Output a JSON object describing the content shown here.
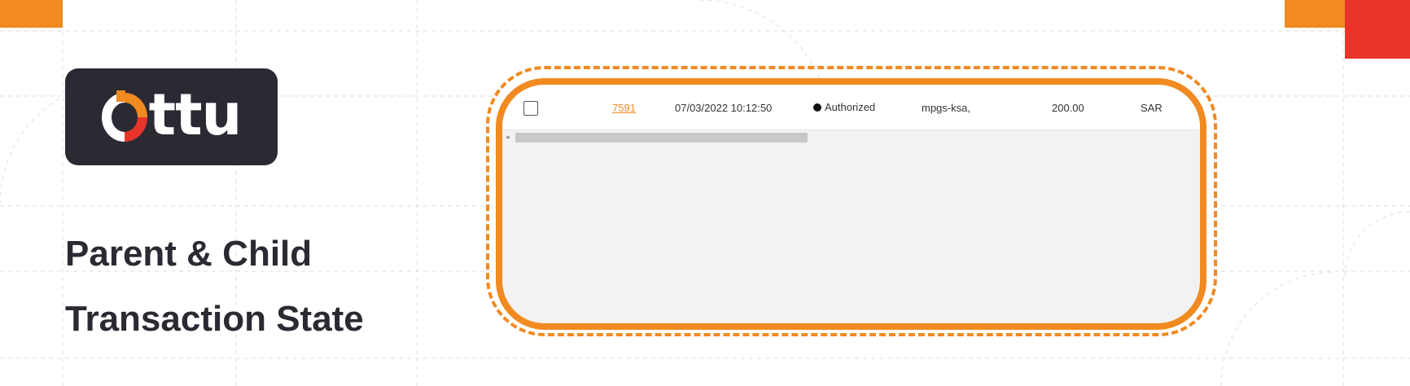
{
  "logo": {
    "text": "ttu",
    "brand_colors": {
      "orange": "#f18a21",
      "red": "#e8342a",
      "dark": "#2b2a33"
    }
  },
  "headline": {
    "line1": "Parent & Child",
    "line2": "Transaction State"
  },
  "table": {
    "rows": [
      {
        "id": "7591",
        "date": "07/03/2022 10:12:50",
        "status": "Authorized",
        "gateway": "mpgs-ksa,",
        "amount": "200.00",
        "currency": "SAR"
      }
    ]
  },
  "scrollbar": {
    "arrow": "◂"
  }
}
